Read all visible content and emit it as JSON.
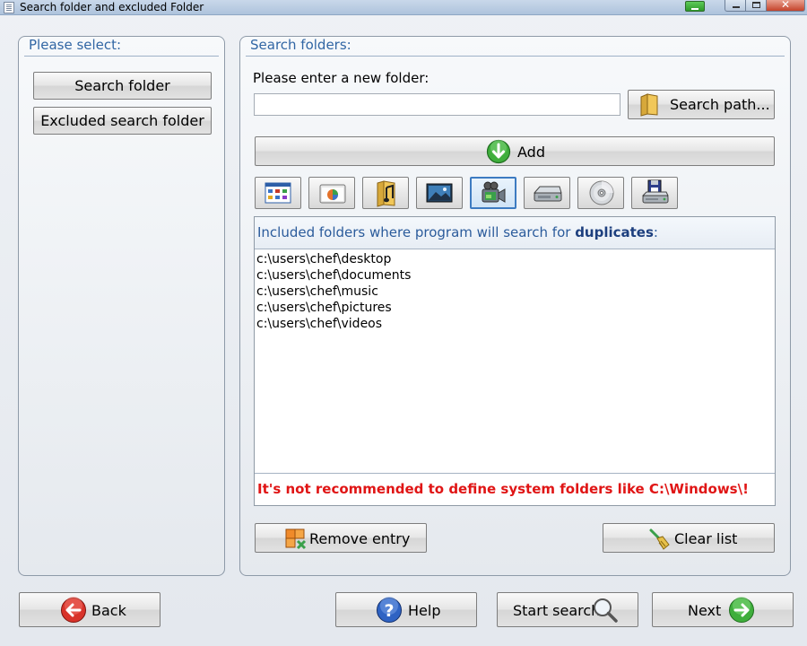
{
  "window": {
    "title": "Search folder and excluded Folder"
  },
  "left_panel": {
    "title": "Please select:",
    "buttons": [
      "Search folder",
      "Excluded search folder"
    ]
  },
  "right_panel": {
    "title": "Search folders:",
    "prompt": "Please enter a new folder:",
    "folder_input": {
      "value": "",
      "placeholder": ""
    },
    "search_path_label": "Search path...",
    "add_label": "Add",
    "type_buttons": [
      {
        "name": "windows-apps-icon"
      },
      {
        "name": "programs-icon"
      },
      {
        "name": "music-icon"
      },
      {
        "name": "pictures-icon"
      },
      {
        "name": "videos-icon",
        "selected": true
      },
      {
        "name": "hard-drive-icon"
      },
      {
        "name": "cd-rom-icon"
      },
      {
        "name": "network-drive-icon"
      }
    ],
    "list_header_prefix": "Included folders where program will search for ",
    "list_header_bold": "duplicates",
    "list_header_suffix": ":",
    "folders": [
      "c:\\users\\chef\\desktop",
      "c:\\users\\chef\\documents",
      "c:\\users\\chef\\music",
      "c:\\users\\chef\\pictures",
      "c:\\users\\chef\\videos"
    ],
    "warning": "It's not recommended to define system folders like C:\\Windows\\!",
    "remove_label": "Remove entry",
    "clear_label": "Clear list"
  },
  "footer": {
    "back_label": "Back",
    "help_label": "Help",
    "start_search_label": "Start search",
    "next_label": "Next"
  },
  "colors": {
    "panel_title": "#3166a4",
    "warning": "#e01515",
    "header_text": "#2b5b9b"
  }
}
